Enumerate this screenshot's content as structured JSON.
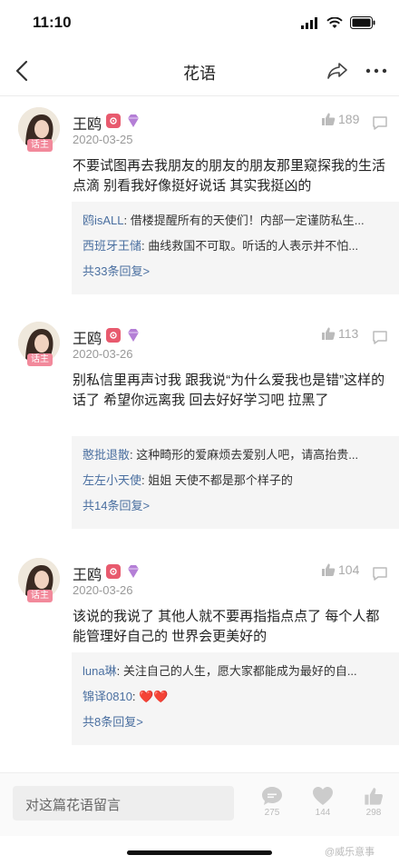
{
  "status": {
    "time": "11:10"
  },
  "nav": {
    "title": "花语"
  },
  "comments": [
    {
      "username": "王鸥",
      "host_tag": "话主",
      "date": "2020-03-25",
      "likes": "189",
      "text": "不要试图再去我朋友的朋友的朋友那里窥探我的生活点滴 别看我好像挺好说话 其实我挺凶的",
      "replies": [
        {
          "user": "鸥isALL",
          "text": ": 借楼提醒所有的天使们！内部一定谨防私生..."
        },
        {
          "user": "西班牙王储",
          "text": ": 曲线救国不可取。听话的人表示并不怕..."
        }
      ],
      "reply_count": "共33条回复>"
    },
    {
      "username": "王鸥",
      "host_tag": "话主",
      "date": "2020-03-26",
      "likes": "113",
      "text": "别私信里再声讨我 跟我说“为什么爱我也是错”这样的话了 希望你远离我 回去好好学习吧 拉黑了",
      "replies": [
        {
          "user": "憨批退散",
          "text": ": 这种畸形的爱麻烦去爱别人吧，请高抬贵..."
        },
        {
          "user": "左左小天使",
          "text": ": 姐姐 天使不都是那个样子的"
        }
      ],
      "reply_count": "共14条回复>"
    },
    {
      "username": "王鸥",
      "host_tag": "话主",
      "date": "2020-03-26",
      "likes": "104",
      "text": "该说的我说了 其他人就不要再指指点点了 每个人都能管理好自己的 世界会更美好的",
      "replies": [
        {
          "user": "luna琳",
          "text": ": 关注自己的人生，愿大家都能成为最好的自..."
        },
        {
          "user": "锦译0810",
          "text": ": ❤️❤️"
        }
      ],
      "reply_count": "共8条回复>"
    }
  ],
  "bottom": {
    "input_placeholder": "对这篇花语留言",
    "comment_count": "275",
    "heart_count": "144",
    "like_count": "298"
  },
  "watermark": "@威乐意事",
  "colors": {
    "link": "#4a6fa0",
    "host_tag": "#f2899b",
    "badge": "#e85a6e"
  }
}
